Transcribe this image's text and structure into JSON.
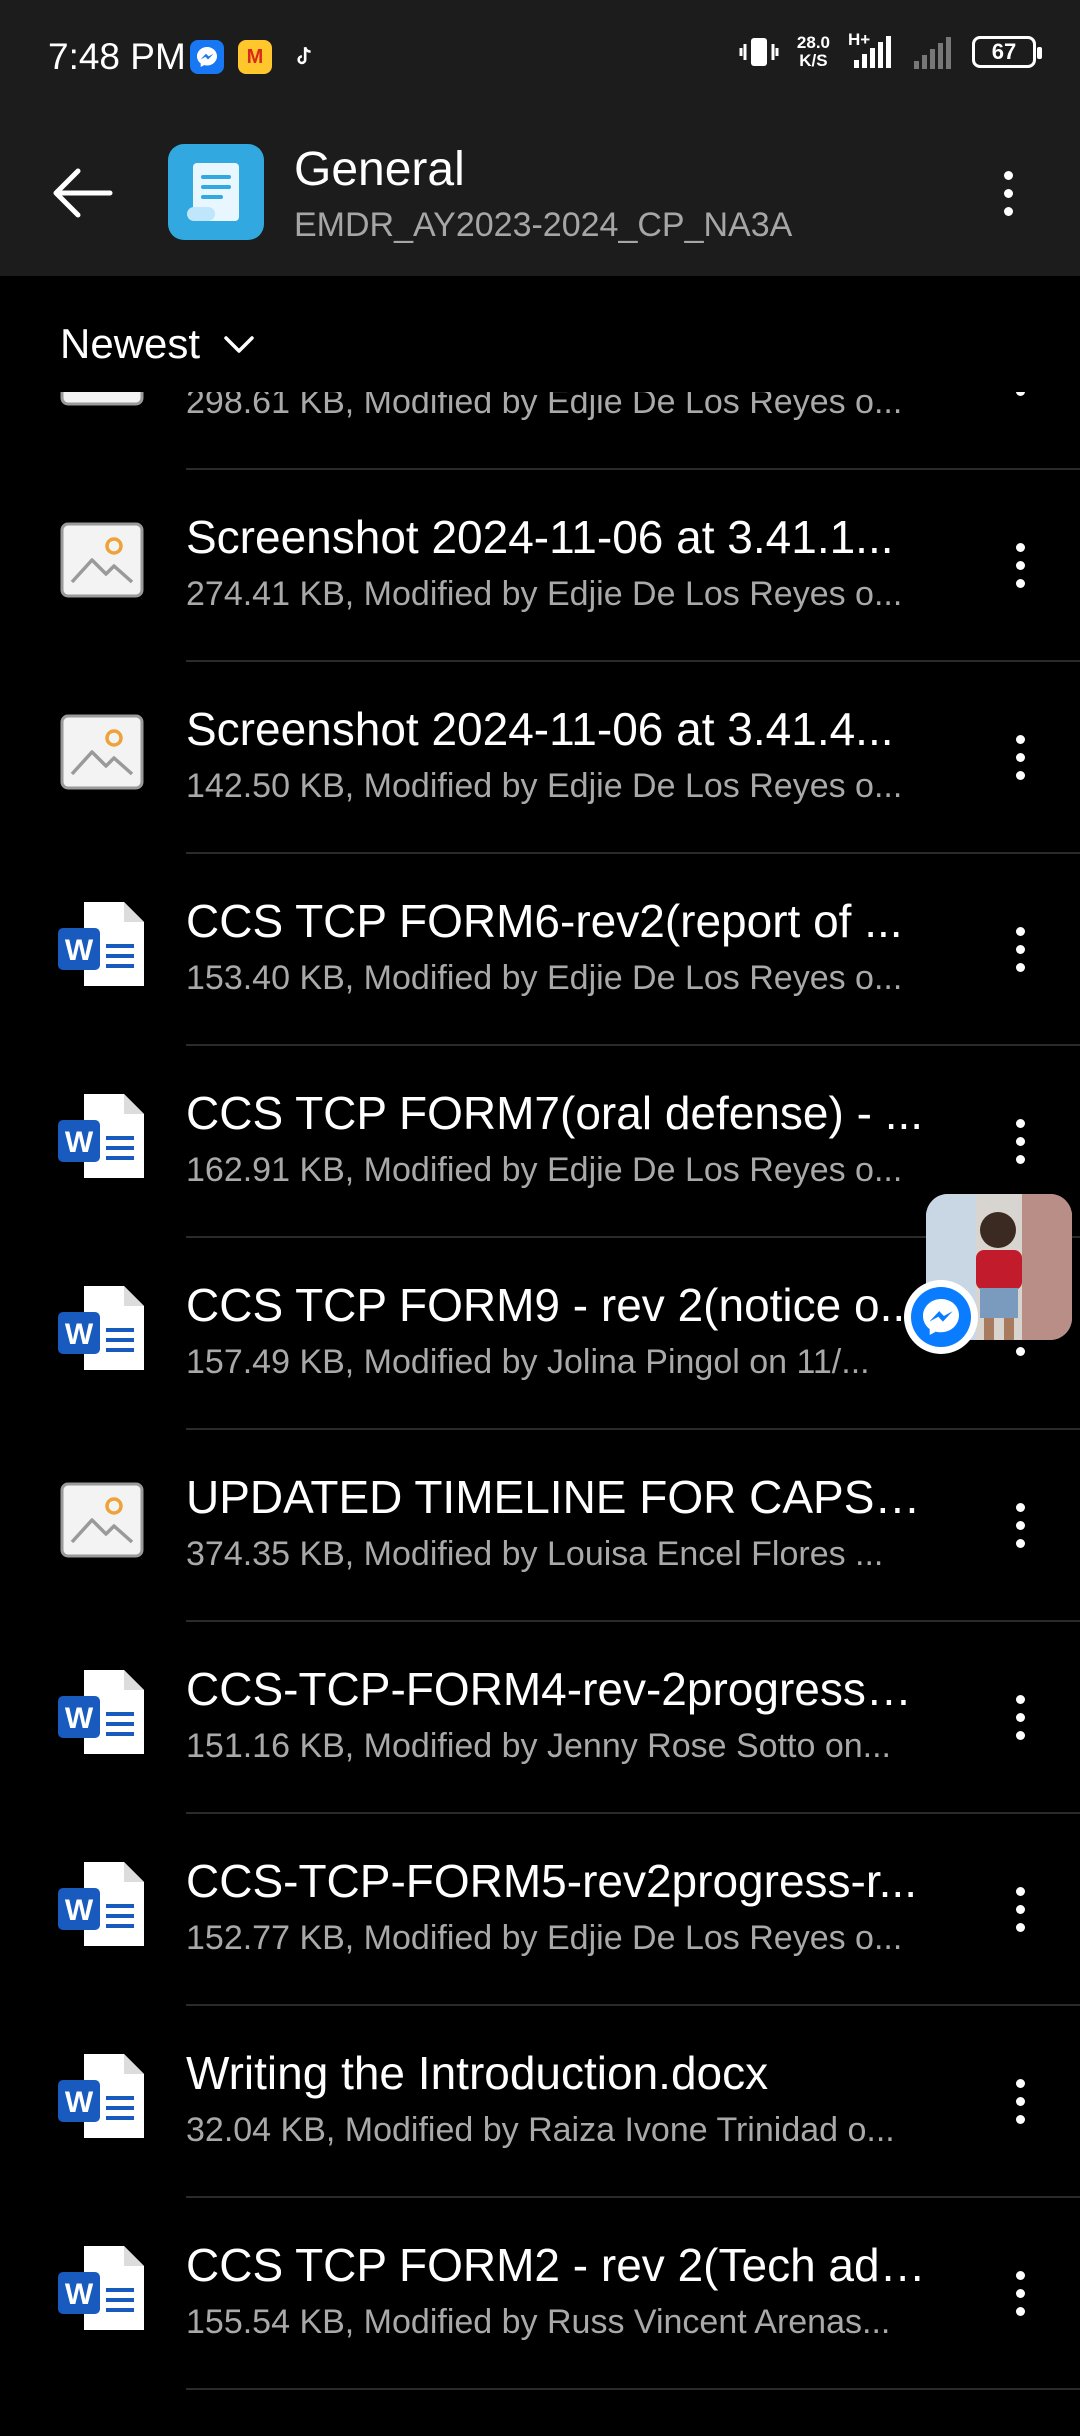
{
  "status_bar": {
    "time": "7:48 PM",
    "net_speed_value": "28.0",
    "net_speed_unit": "K/S",
    "network_type": "H+",
    "battery": "67",
    "app_icons": [
      "messenger-icon",
      "mcdonalds-icon",
      "tiktok-icon"
    ]
  },
  "header": {
    "title": "General",
    "subtitle": "EMDR_AY2023-2024_CP_NA3A"
  },
  "sort": {
    "label": "Newest"
  },
  "files": [
    {
      "type": "image",
      "name": "",
      "meta": "298.61 KB, Modified by Edjie De Los Reyes o..."
    },
    {
      "type": "image",
      "name": "Screenshot 2024-11-06 at 3.41.1...",
      "meta": "274.41 KB, Modified by Edjie De Los Reyes o..."
    },
    {
      "type": "image",
      "name": "Screenshot 2024-11-06 at 3.41.4...",
      "meta": "142.50 KB, Modified by Edjie De Los Reyes o..."
    },
    {
      "type": "word",
      "name": "CCS TCP FORM6-rev2(report of ...",
      "meta": "153.40 KB, Modified by Edjie De Los Reyes o..."
    },
    {
      "type": "word",
      "name": "CCS TCP FORM7(oral defense) - ...",
      "meta": "162.91 KB, Modified by Edjie De Los Reyes o..."
    },
    {
      "type": "word",
      "name": "CCS TCP FORM9 - rev 2(notice o...",
      "meta": "157.49 KB, Modified by Jolina Pingol on 11/..."
    },
    {
      "type": "image",
      "name": "UPDATED TIMELINE FOR CAPST...",
      "meta": "374.35 KB, Modified by Louisa Encel Flores ..."
    },
    {
      "type": "word",
      "name": "CCS-TCP-FORM4-rev-2progress-r...",
      "meta": "151.16 KB, Modified by Jenny Rose Sotto on..."
    },
    {
      "type": "word",
      "name": "CCS-TCP-FORM5-rev2progress-r...",
      "meta": "152.77 KB, Modified by Edjie De Los Reyes o..."
    },
    {
      "type": "word",
      "name": "Writing the Introduction.docx",
      "meta": "32.04 KB, Modified by Raiza Ivone Trinidad o..."
    },
    {
      "type": "word",
      "name": "CCS TCP FORM2 - rev 2(Tech ad ...",
      "meta": "155.54 KB, Modified by Russ Vincent Arenas..."
    }
  ],
  "colors": {
    "background": "#000000",
    "header_bg": "#1c1c1c",
    "folder_icon": "#31a8e0",
    "word_blue": "#185abd",
    "secondary_text": "#a9a9a9",
    "messenger_blue": "#0a7cff"
  }
}
